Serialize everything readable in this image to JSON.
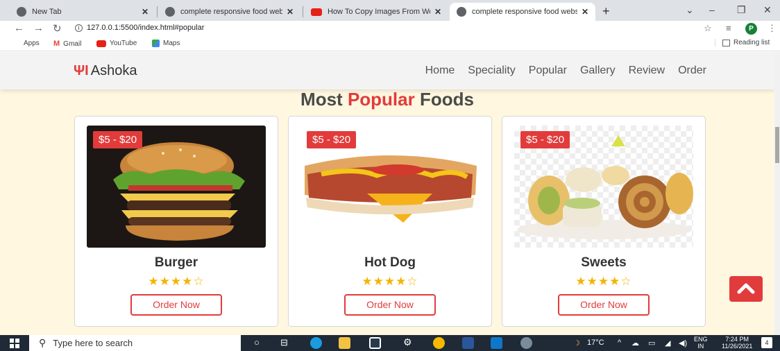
{
  "browser": {
    "tabs": [
      {
        "title": "New Tab",
        "icon": "globe-icon"
      },
      {
        "title": "complete responsive food websit",
        "icon": "globe-icon"
      },
      {
        "title": "How To Copy Images From Word",
        "icon": "youtube-icon"
      },
      {
        "title": "complete responsive food websit",
        "icon": "globe-icon",
        "active": true
      }
    ],
    "url": "127.0.0.1:5500/index.html#popular",
    "profile_initial": "P",
    "bookmarks": [
      {
        "label": "Apps",
        "icon": "apps-grid-icon"
      },
      {
        "label": "Gmail",
        "icon": "gmail-icon"
      },
      {
        "label": "YouTube",
        "icon": "youtube-icon"
      },
      {
        "label": "Maps",
        "icon": "maps-icon"
      }
    ],
    "reading_list": "Reading list"
  },
  "site": {
    "logo_text": "Ashoka",
    "nav": [
      "Home",
      "Speciality",
      "Popular",
      "Gallery",
      "Review",
      "Order"
    ],
    "section_title": {
      "before": "Most ",
      "accent": "Popular",
      "after": " Foods"
    },
    "accent_color": "#e23b3b",
    "products": [
      {
        "name": "Burger",
        "price": "$5 - $20",
        "rating": 4,
        "rating_max": 5,
        "button": "Order Now"
      },
      {
        "name": "Hot Dog",
        "price": "$5 - $20",
        "rating": 4,
        "rating_max": 5,
        "button": "Order Now"
      },
      {
        "name": "Sweets",
        "price": "$5 - $20",
        "rating": 4,
        "rating_max": 5,
        "button": "Order Now"
      }
    ]
  },
  "taskbar": {
    "search_placeholder": "Type here to search",
    "temperature": "17°C",
    "lang_line1": "ENG",
    "lang_line2": "IN",
    "time": "7:24 PM",
    "date": "11/26/2021",
    "notifications": "4"
  }
}
